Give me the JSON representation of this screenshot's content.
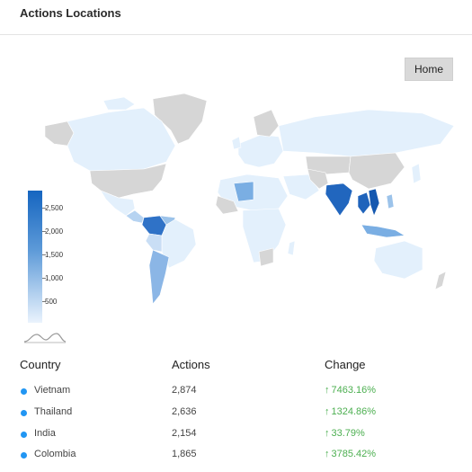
{
  "card": {
    "title": "Actions Locations"
  },
  "home_button": {
    "label": "Home"
  },
  "legend": {
    "labels": [
      "2,500",
      "2,000",
      "1,500",
      "1,000",
      "500"
    ],
    "colors": {
      "high": "#1565c0",
      "low": "#eaf3fd"
    }
  },
  "table": {
    "headers": {
      "country": "Country",
      "actions": "Actions",
      "change": "Change"
    },
    "rows": [
      {
        "country": "Vietnam",
        "actions": "2,874",
        "change": "7463.16%",
        "arrow": "↑"
      },
      {
        "country": "Thailand",
        "actions": "2,636",
        "change": "1324.86%",
        "arrow": "↑"
      },
      {
        "country": "India",
        "actions": "2,154",
        "change": "33.79%",
        "arrow": "↑"
      },
      {
        "country": "Colombia",
        "actions": "1,865",
        "change": "3785.42%",
        "arrow": "↑"
      }
    ]
  },
  "colors": {
    "accent": "#2196f3",
    "positive": "#4caf50",
    "no_data": "#d6d6d6"
  }
}
